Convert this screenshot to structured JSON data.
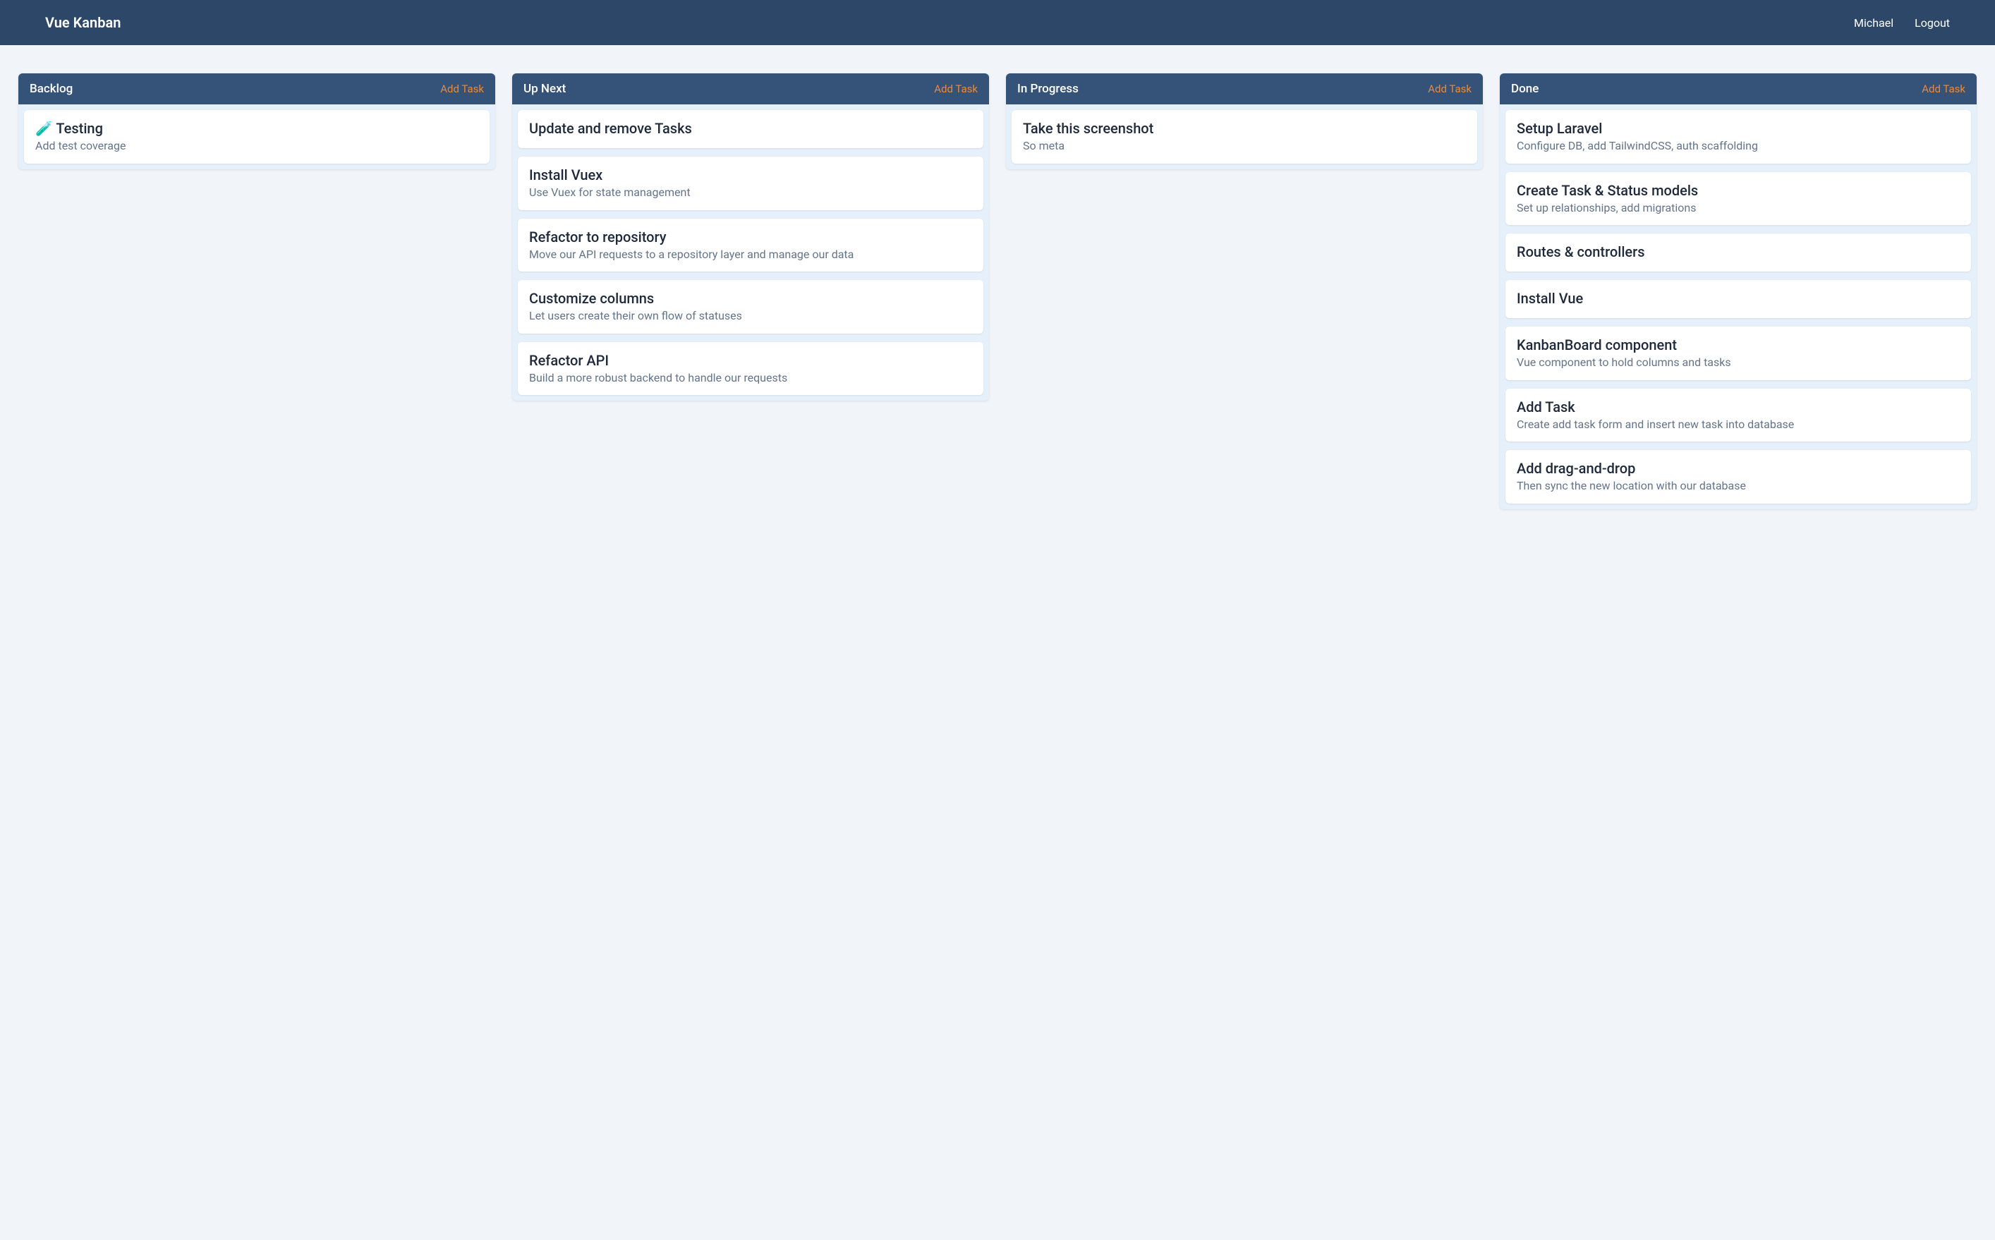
{
  "header": {
    "title": "Vue Kanban",
    "user": "Michael",
    "logout": "Logout"
  },
  "add_task_label": "Add Task",
  "columns": [
    {
      "title": "Backlog",
      "tasks": [
        {
          "title": "🧪 Testing",
          "description": "Add test coverage"
        }
      ]
    },
    {
      "title": "Up Next",
      "tasks": [
        {
          "title": "Update and remove Tasks",
          "description": ""
        },
        {
          "title": "Install Vuex",
          "description": "Use Vuex for state management"
        },
        {
          "title": "Refactor to repository",
          "description": "Move our API requests to a repository layer and manage our data"
        },
        {
          "title": "Customize columns",
          "description": "Let users create their own flow of statuses"
        },
        {
          "title": "Refactor API",
          "description": "Build a more robust backend to handle our requests"
        }
      ]
    },
    {
      "title": "In Progress",
      "tasks": [
        {
          "title": "Take this screenshot",
          "description": "So meta"
        }
      ]
    },
    {
      "title": "Done",
      "tasks": [
        {
          "title": "Setup Laravel",
          "description": "Configure DB, add TailwindCSS, auth scaffolding"
        },
        {
          "title": "Create Task & Status models",
          "description": "Set up relationships, add migrations"
        },
        {
          "title": "Routes & controllers",
          "description": ""
        },
        {
          "title": "Install Vue",
          "description": ""
        },
        {
          "title": "KanbanBoard component",
          "description": "Vue component to hold columns and tasks"
        },
        {
          "title": "Add Task",
          "description": "Create add task form and insert new task into database"
        },
        {
          "title": "Add drag-and-drop",
          "description": "Then sync the new location with our database"
        }
      ]
    }
  ]
}
